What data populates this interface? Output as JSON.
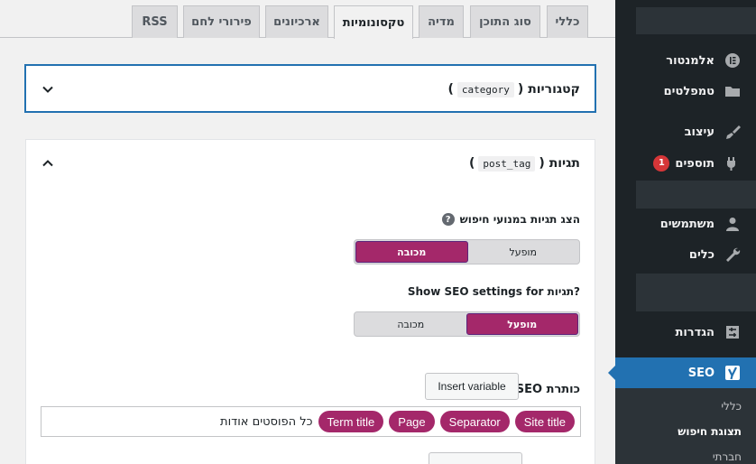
{
  "tabs": [
    {
      "label": "כללי"
    },
    {
      "label": "סוג התוכן"
    },
    {
      "label": "מדיה"
    },
    {
      "label": "טקסונומיות"
    },
    {
      "label": "ארכיונים"
    },
    {
      "label": "פירורי לחם"
    },
    {
      "label": "RSS"
    }
  ],
  "active_tab": "טקסונומיות",
  "categories_box": {
    "title": "קטגוריות",
    "slug": "category"
  },
  "tags_box": {
    "title": "תגיות",
    "slug": "post_tag",
    "search_toggle": {
      "label": "הצג תגיות במנועי חיפוש",
      "help": "?",
      "on_label": "מופעל",
      "off_label": "מכובה",
      "selected": "off"
    },
    "seo_toggle": {
      "label": "Show SEO settings for תגיות?",
      "on_label": "מופעל",
      "off_label": "מכובה",
      "selected": "on"
    },
    "seo_title": {
      "label": "כותרת SEO",
      "insert_label": "Insert variable",
      "pills": [
        "Site title",
        "Separator",
        "Page",
        "Term title"
      ],
      "text": "כל הפוסטים אודות"
    }
  },
  "sidebar": {
    "items": [
      {
        "label": "אלמנטור",
        "icon": "elementor-icon"
      },
      {
        "label": "טמפלטים",
        "icon": "folder-icon"
      },
      {
        "label": "עיצוב",
        "icon": "brush-icon"
      },
      {
        "label": "תוספים",
        "icon": "plugin-icon",
        "badge": "1"
      },
      {
        "label": "משתמשים",
        "icon": "user-icon"
      },
      {
        "label": "כלים",
        "icon": "wrench-icon"
      },
      {
        "label": "הגדרות",
        "icon": "settings-icon"
      },
      {
        "label": "SEO",
        "icon": "yoast-icon"
      }
    ],
    "submenu": [
      {
        "label": "כללי"
      },
      {
        "label": "תצוגת חיפוש"
      },
      {
        "label": "חברתי"
      }
    ]
  },
  "colors": {
    "accent": "#a4286a",
    "sidebar_bg": "#1d2327",
    "active_menu": "#2271b1",
    "badge": "#d63638"
  }
}
